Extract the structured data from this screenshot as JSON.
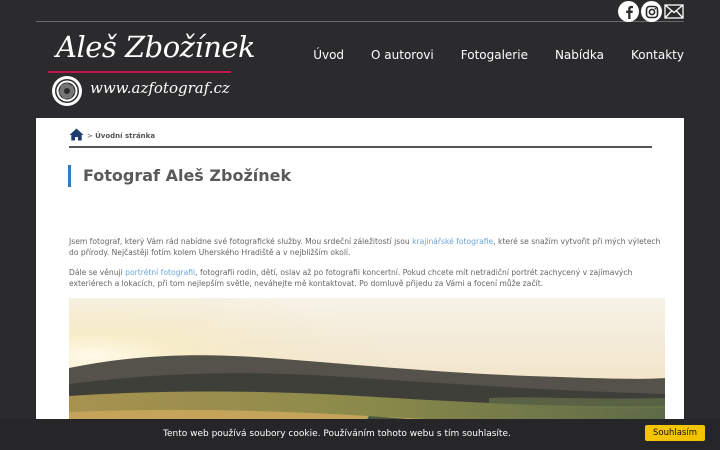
{
  "header": {
    "logo_name": "Aleš Zbožínek",
    "logo_url": "www.azfotograf.cz",
    "social": [
      "facebook-icon",
      "instagram-icon",
      "mail-icon"
    ],
    "nav": [
      {
        "label": "Úvod"
      },
      {
        "label": "O autorovi"
      },
      {
        "label": "Fotogalerie"
      },
      {
        "label": "Nabídka"
      },
      {
        "label": "Kontakty"
      }
    ]
  },
  "breadcrumb": {
    "separator": ">",
    "current": "Úvodní stránka"
  },
  "main": {
    "title": "Fotograf Aleš Zbožínek",
    "para1_before": "Jsem fotograf, který Vám rád nabídne své fotografické služby. Mou srdeční záležitostí jsou ",
    "para1_link": "krajinářské fotografie",
    "para1_after": ", které se snažím vytvořit při mých výletech do přírody. Nejčastěji fotím kolem Uherského Hradiště a v nejbližším okolí.",
    "para2_before": "Dále se věnuji ",
    "para2_link": "portrétní fotografii",
    "para2_after": ", fotografii rodin, dětí, oslav až po fotografii koncertní. Pokud chcete mít netradiční portrét zachycený v zajímavých exteriérech a lokacích, při tom nejlepším světle, neváhejte mě kontaktovat. Po domluvě přijedu za Vámi a focení může začít."
  },
  "cookie": {
    "text": "Tento web používá soubory cookie. Používáním tohoto webu s tím souhlasíte.",
    "button": "Souhlasím"
  },
  "colors": {
    "background": "#2b2b2d",
    "accent_title": "#2f7cc1",
    "logo_rule": "#c0144a",
    "link": "#6aa6d8",
    "cookie_button": "#f5c400"
  }
}
